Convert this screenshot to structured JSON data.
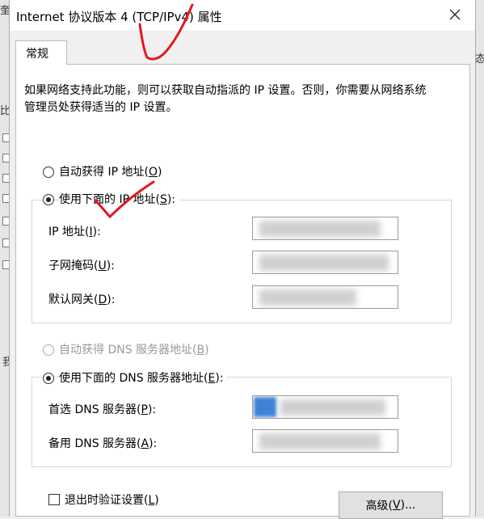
{
  "window": {
    "title": "Internet 协议版本 4 (TCP/IPv4) 属性"
  },
  "tabs": [
    {
      "label": "常规",
      "selected": true
    }
  ],
  "description": "如果网络支持此功能，则可以获取自动指派的 IP 设置。否则，你需要从网络系统管理员处获得适当的 IP 设置。",
  "ip": {
    "auto_label": "自动获得 IP 地址(",
    "auto_key": "O",
    "manual_label": "使用下面的 IP 地址(",
    "manual_key": "S",
    "selected": "manual",
    "fields": [
      {
        "label": "IP 地址(",
        "key": "I",
        "value": ""
      },
      {
        "label": "子网掩码(",
        "key": "U",
        "value": ""
      },
      {
        "label": "默认网关(",
        "key": "D",
        "value": ""
      }
    ]
  },
  "dns": {
    "auto_label": "自动获得 DNS 服务器地址(",
    "auto_key": "B",
    "auto_disabled": true,
    "manual_label": "使用下面的 DNS 服务器地址(",
    "manual_key": "E",
    "selected": "manual",
    "fields": [
      {
        "label": "首选 DNS 服务器(",
        "key": "P",
        "value": ""
      },
      {
        "label": "备用 DNS 服务器(",
        "key": "A",
        "value": ""
      }
    ]
  },
  "validate": {
    "label": "退出时验证设置(",
    "key": "L",
    "checked": false
  },
  "advanced": {
    "label": "高级(",
    "key": "V",
    "suffix": ")..."
  },
  "close_paren": "):",
  "close_paren_plain": ")",
  "background_fragments": [
    "奎",
    "比",
    "态",
    "我"
  ],
  "colors": {
    "accent": "#0078d7",
    "annotation": "#e0181e"
  }
}
